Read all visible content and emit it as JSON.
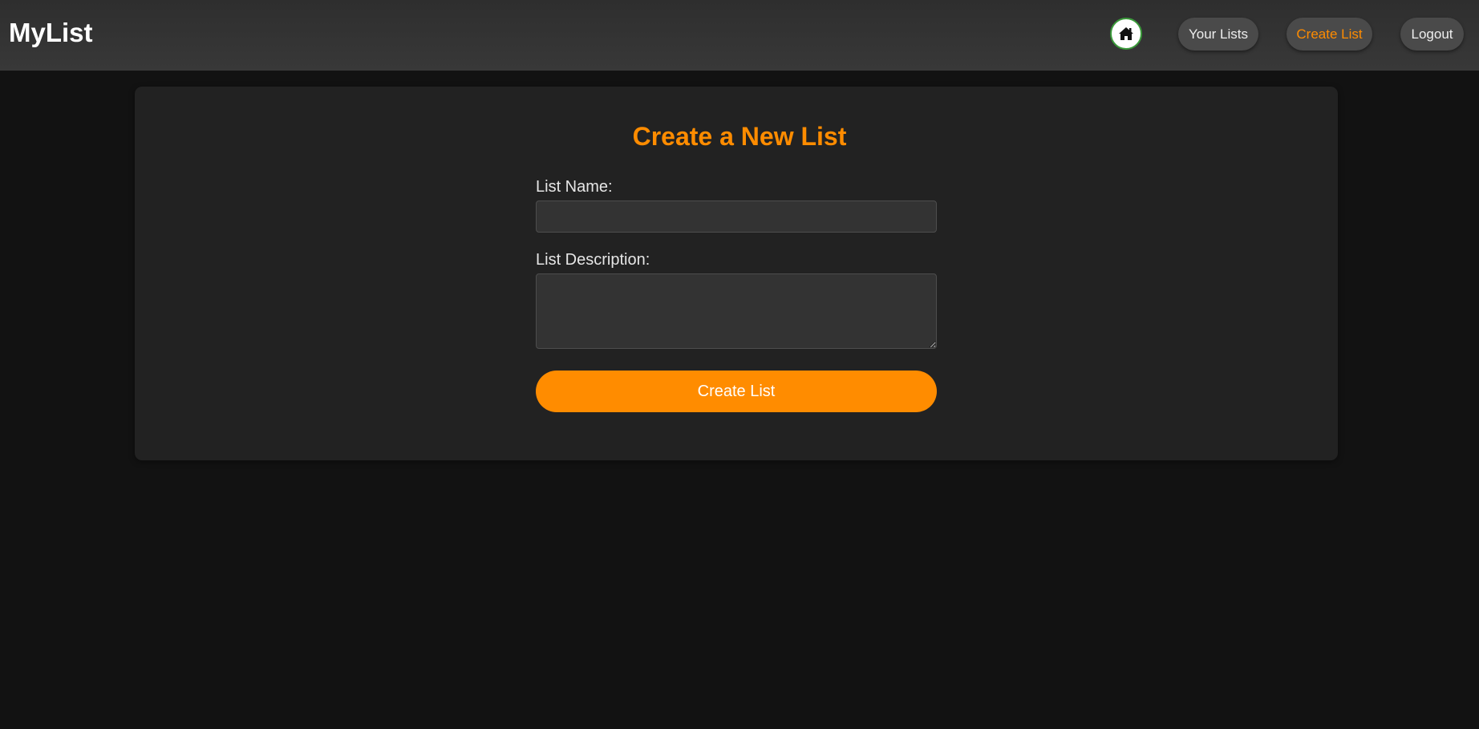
{
  "header": {
    "brand": "MyList",
    "home_icon": "home-icon",
    "nav": [
      {
        "label": "Your Lists",
        "active": false
      },
      {
        "label": "Create List",
        "active": true
      },
      {
        "label": "Logout",
        "active": false
      }
    ]
  },
  "form": {
    "title": "Create a New List",
    "name_label": "List Name:",
    "name_value": "",
    "description_label": "List Description:",
    "description_value": "",
    "submit_label": "Create List"
  },
  "colors": {
    "accent": "#ff8c00",
    "background": "#121212",
    "card": "#222222",
    "header": "#333333",
    "home_ring": "#3a9a3a"
  }
}
